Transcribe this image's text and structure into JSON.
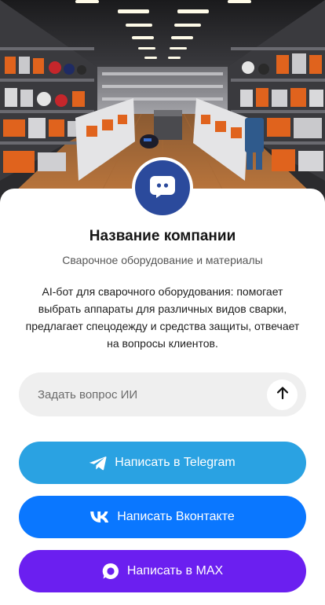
{
  "colors": {
    "avatar_bg": "#2b4a9c",
    "telegram": "#2aa2e2",
    "vk": "#0a77ff",
    "max": "#6b1ff0",
    "ask_bg": "#efefef"
  },
  "hero": {
    "icon": "welding-store-photo"
  },
  "company": {
    "avatar_icon": "chat-bot-icon",
    "name": "Название компании",
    "subtitle": "Сварочное оборудование и материалы",
    "description": "AI-бот для сварочного оборудования: помогает выбрать аппараты для различных видов сварки, предлагает спецодежду и средства защиты, отвечает на вопросы клиентов."
  },
  "ask": {
    "placeholder": "Задать вопрос ИИ",
    "value": "",
    "send_icon": "arrow-up-icon"
  },
  "buttons": {
    "telegram": {
      "label": "Написать в Telegram",
      "icon": "telegram-icon"
    },
    "vk": {
      "label": "Написать Вконтакте",
      "icon": "vk-icon"
    },
    "max": {
      "label": "Написать в MAX",
      "icon": "max-icon"
    }
  }
}
